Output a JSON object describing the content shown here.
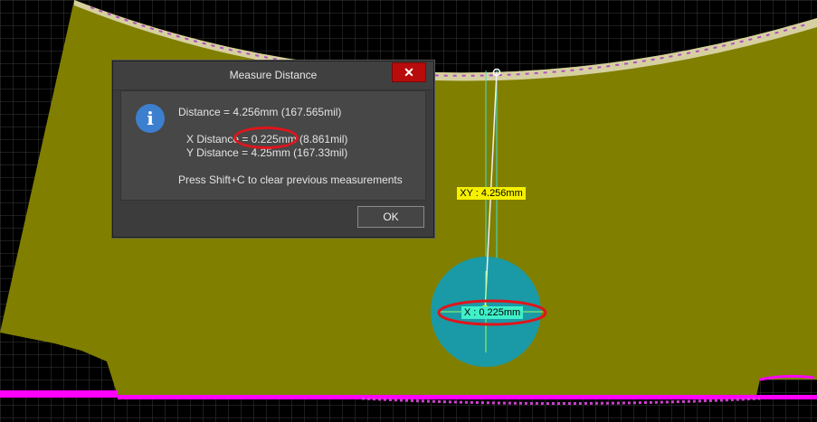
{
  "dialog": {
    "title": "Measure Distance",
    "close_label": "✕",
    "icon": "info-icon",
    "info_glyph": "i",
    "distance": "Distance = 4.256mm (167.565mil)",
    "x_distance": "X Distance = 0.225mm (8.861mil)",
    "y_distance": "Y Distance = 4.25mm (167.33mil)",
    "hint": "Press Shift+C to clear previous measurements",
    "ok_label": "OK"
  },
  "canvas_labels": {
    "xy": "XY : 4.256mm",
    "x": "X : 0.225mm"
  },
  "colors": {
    "board": "#807f00",
    "grid_bg": "#000000",
    "grid_line": "#3a3a3a",
    "copper_edge": "#d6d0a0",
    "pad_teal": "#1a9aa6",
    "magenta": "#ff00ff",
    "annotation_red": "#e0141c",
    "dialog_bg": "#3c3c3c"
  }
}
